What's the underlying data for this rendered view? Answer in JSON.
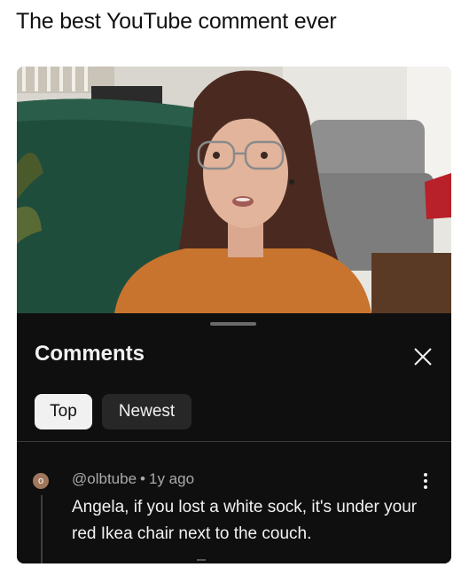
{
  "caption": "The best YouTube comment ever",
  "panel": {
    "title": "Comments",
    "close_icon": "close-icon",
    "tabs": [
      {
        "label": "Top",
        "selected": true
      },
      {
        "label": "Newest",
        "selected": false
      }
    ]
  },
  "comment": {
    "avatar_letter": "o",
    "author": "@olbtube",
    "separator": "•",
    "time": "1y ago",
    "text": "Angela, if you lost a white sock, it's under your red Ikea chair next to the couch.",
    "more_icon": "more-vertical-icon"
  },
  "colors": {
    "panel_bg": "#0f0f0f",
    "chip_selected_bg": "#f1f1f1",
    "chip_bg": "#272727",
    "text_primary": "#f1f1f1",
    "text_secondary": "#aaaaaa",
    "avatar_bg": "#a0775c"
  }
}
